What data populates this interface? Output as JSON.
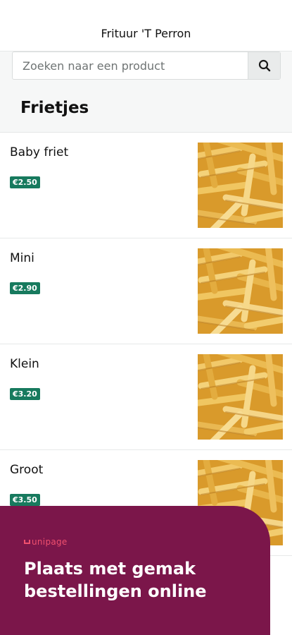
{
  "header": {
    "title": "Frituur 'T Perron"
  },
  "search": {
    "placeholder": "Zoeken naar een product",
    "icon": "search-icon"
  },
  "category": {
    "title": "Frietjes"
  },
  "products": [
    {
      "name": "Baby friet",
      "price": "€2.50"
    },
    {
      "name": "Mini",
      "price": "€2.90"
    },
    {
      "name": "Klein",
      "price": "€3.20"
    },
    {
      "name": "Groot",
      "price": "€3.50"
    }
  ],
  "colors": {
    "price_badge": "#177a5e",
    "promo_bg": "#7b164a",
    "promo_logo": "#f0506e"
  },
  "promo": {
    "logo": "unipage",
    "text": "Plaats met gemak bestellingen online"
  }
}
